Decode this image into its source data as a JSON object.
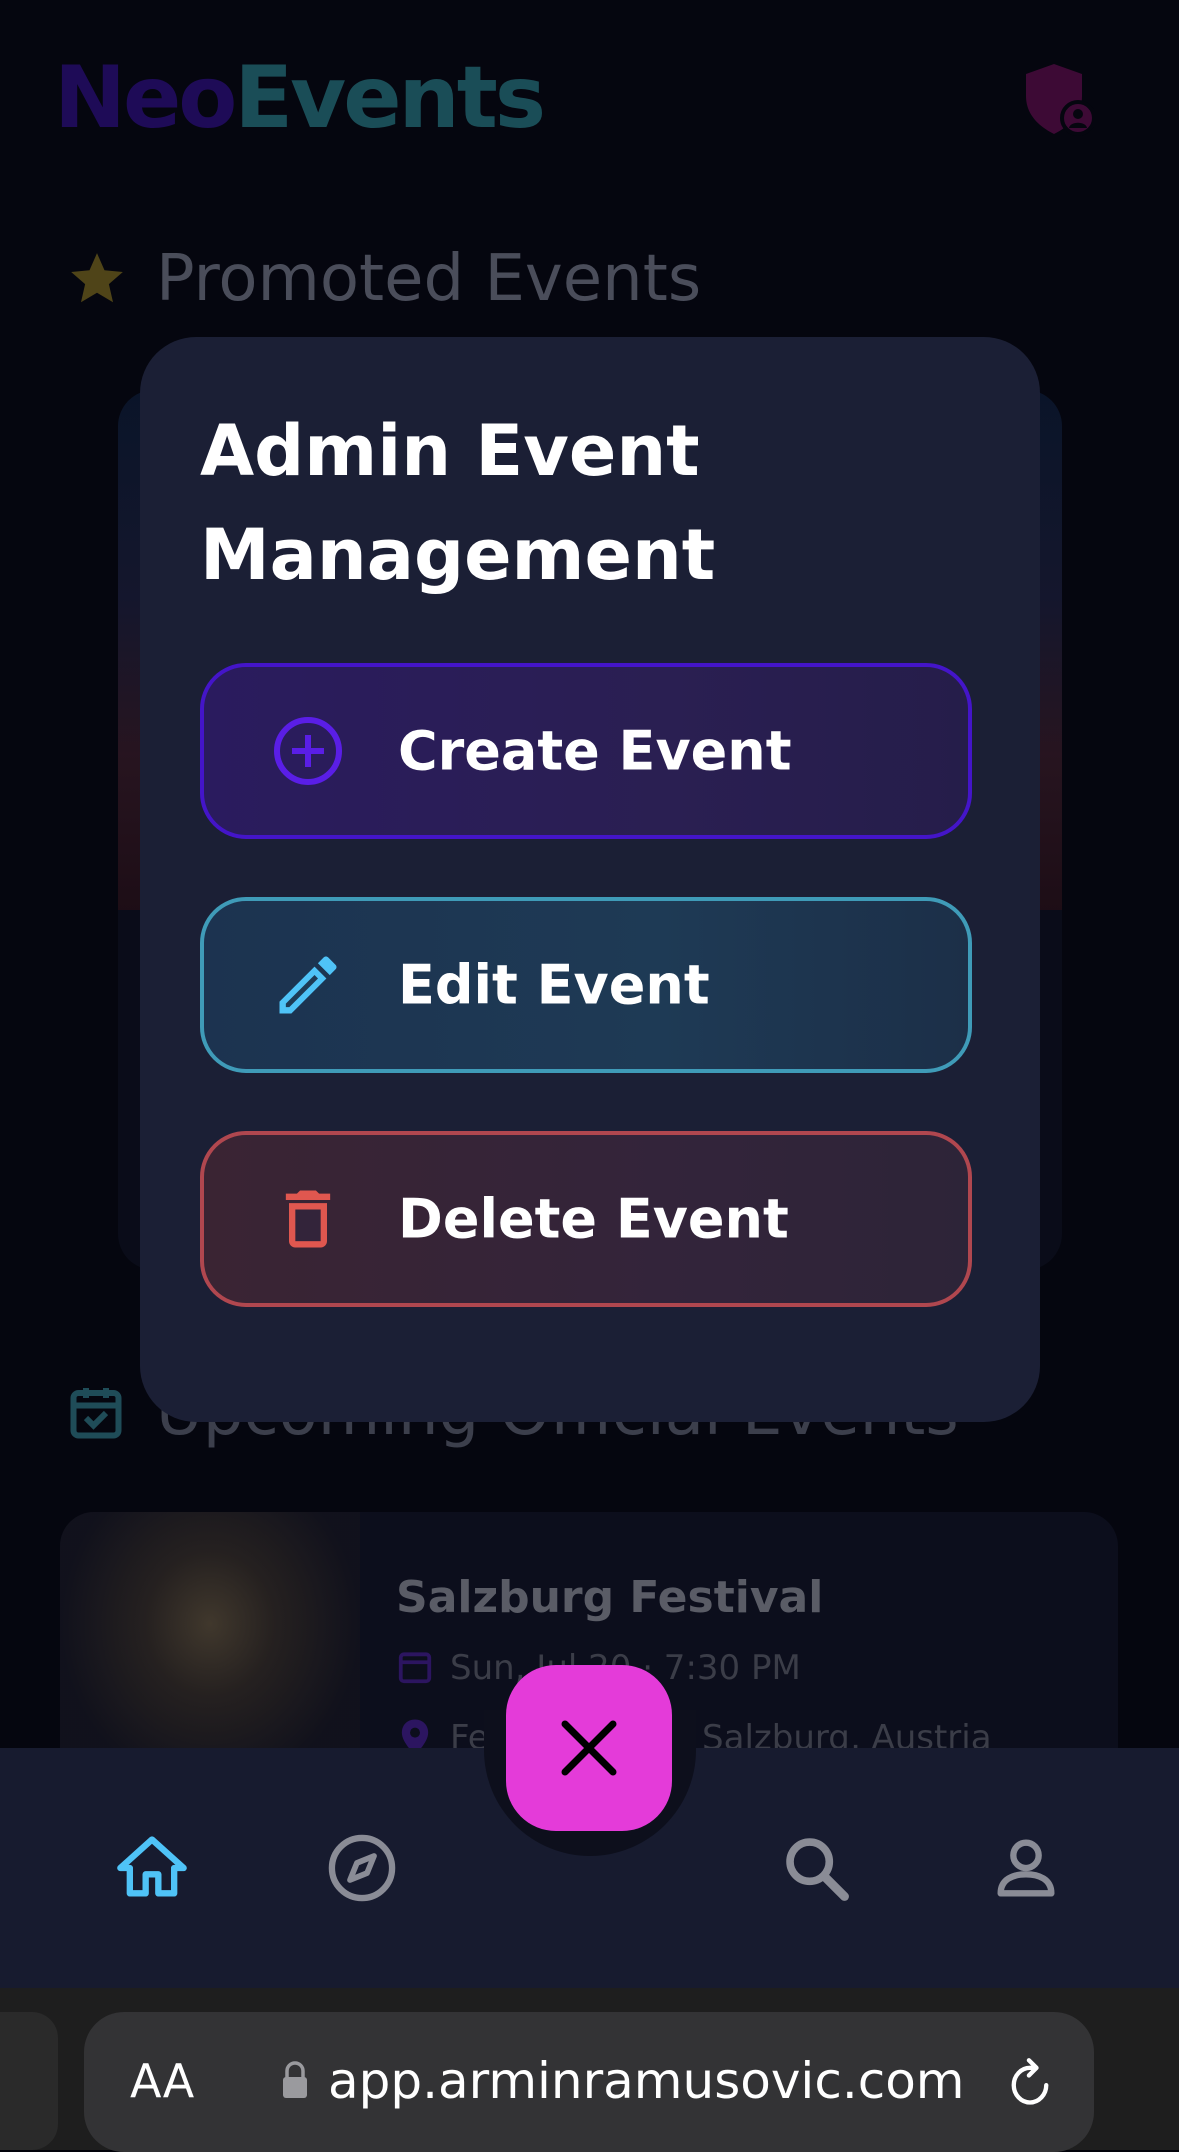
{
  "header": {
    "logo_part1": "Neo",
    "logo_part2": "Events",
    "admin_icon": "admin-shield-icon"
  },
  "sections": {
    "promoted_title": "Promoted Events",
    "upcoming_title": "Upcoming Official Events"
  },
  "upcoming_event": {
    "title": "Salzburg Festival",
    "date": "Sun, Jul 20 · 7:30 PM",
    "location": "Festspielhaus, Salzburg, Austria"
  },
  "modal": {
    "title": "Admin Event Management",
    "actions": [
      {
        "label": "Create Event",
        "icon": "plus-circle-icon"
      },
      {
        "label": "Edit Event",
        "icon": "pencil-icon"
      },
      {
        "label": "Delete Event",
        "icon": "trash-icon"
      }
    ]
  },
  "bottom_nav": {
    "items": [
      "home-icon",
      "explore-icon",
      "search-icon",
      "profile-icon"
    ],
    "active": "home",
    "fab_icon": "close-icon"
  },
  "browser": {
    "text_size_label": "AA",
    "url": "app.arminramusovic.com"
  },
  "colors": {
    "accent_purple": "#4415c9",
    "accent_teal": "#3f9bb8",
    "accent_red": "#e0574f",
    "fab": "#e43bd9",
    "nav_active": "#4fc3f7"
  }
}
